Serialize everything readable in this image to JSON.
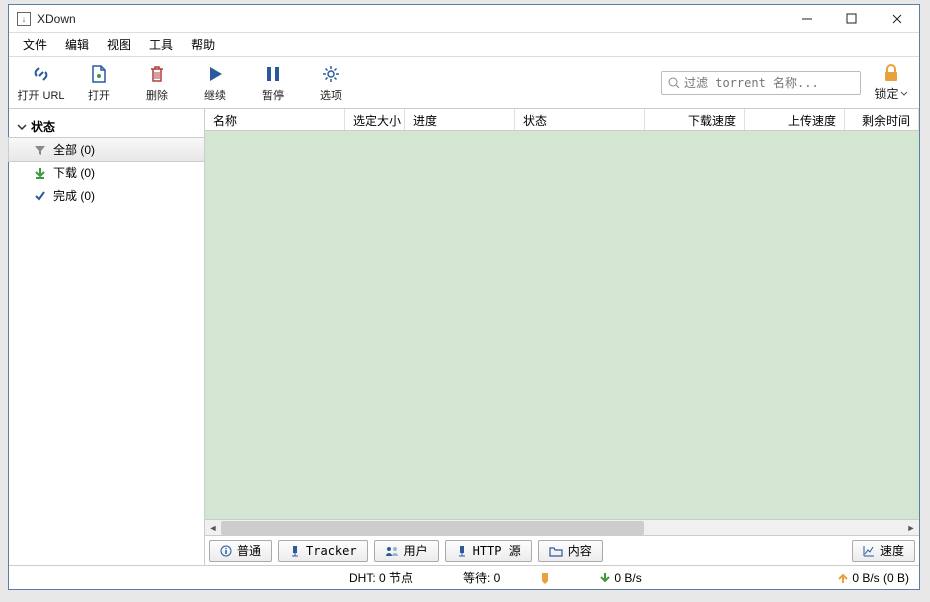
{
  "title": "XDown",
  "menu": {
    "file": "文件",
    "edit": "编辑",
    "view": "视图",
    "tools": "工具",
    "help": "帮助"
  },
  "toolbar": {
    "open_url": "打开 URL",
    "open": "打开",
    "delete": "删除",
    "resume": "继续",
    "pause": "暂停",
    "options": "选项",
    "search_placeholder": "过滤 torrent 名称...",
    "lock": "锁定"
  },
  "sidebar": {
    "root": "状态",
    "items": [
      {
        "label": "全部 (0)",
        "icon": "filter"
      },
      {
        "label": "下载 (0)",
        "icon": "down"
      },
      {
        "label": "完成 (0)",
        "icon": "check"
      }
    ]
  },
  "columns": {
    "name": "名称",
    "selected_size": "选定大小",
    "progress": "进度",
    "status": "状态",
    "dl_speed": "下载速度",
    "ul_speed": "上传速度",
    "eta": "剩余时间"
  },
  "tabs": {
    "general": "普通",
    "tracker": "Tracker",
    "peers": "用户",
    "http": "HTTP 源",
    "content": "内容",
    "speed": "速度"
  },
  "status": {
    "dht": "DHT: 0 节点",
    "waiting": "等待: 0",
    "dl": "0 B/s",
    "ul": "0 B/s (0 B)"
  },
  "colors": {
    "accent": "#2a5a9c",
    "table_bg": "#d3e6d1",
    "orange": "#e9a13b",
    "green": "#3c9a3c",
    "red": "#b43c3c"
  }
}
